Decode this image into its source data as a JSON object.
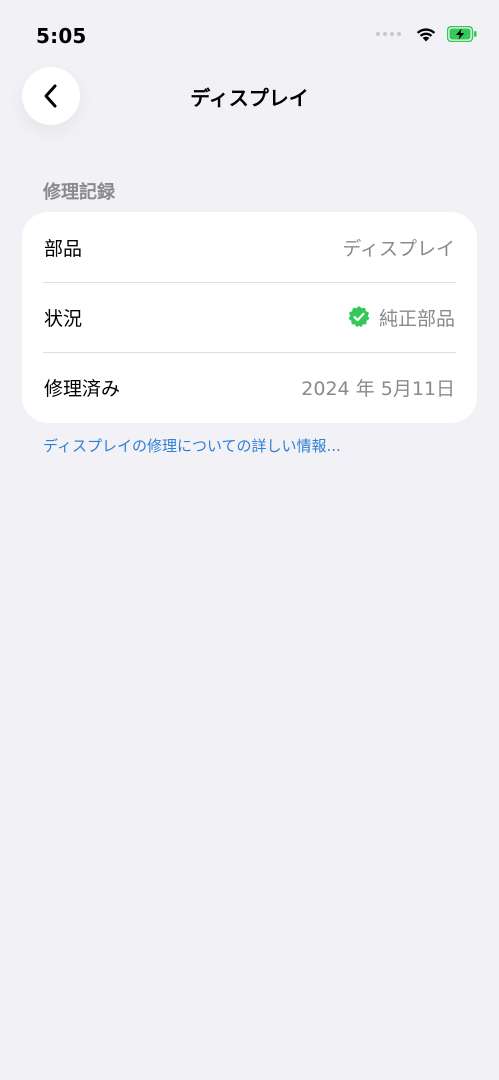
{
  "status_bar": {
    "time": "5:05",
    "icons": [
      "signal-dots-icon",
      "wifi-icon",
      "battery-charging-icon"
    ],
    "battery_color": "#34c759"
  },
  "nav": {
    "title": "ディスプレイ",
    "back_icon": "chevron-left-icon"
  },
  "section": {
    "header": "修理記録",
    "rows": [
      {
        "label": "部品",
        "value": "ディスプレイ"
      },
      {
        "label": "状況",
        "value": "純正部品",
        "icon": "verified-badge-icon",
        "icon_color": "#34c759"
      },
      {
        "label": "修理済み",
        "value": "2024 年 5月11日"
      }
    ]
  },
  "link": {
    "text": "ディスプレイの修理についての詳しい情報...",
    "color": "#2f7fd6"
  }
}
